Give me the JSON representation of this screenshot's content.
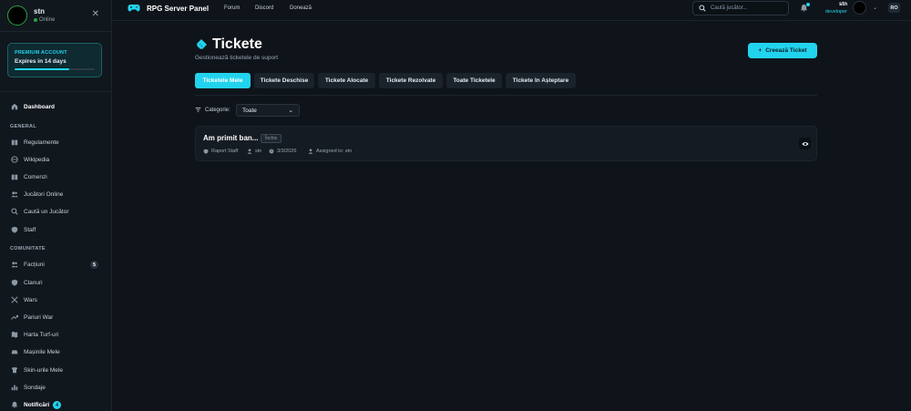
{
  "sidebar": {
    "user": {
      "name": "stn",
      "status": "Online"
    },
    "premium": {
      "title": "PREMIUM ACCOUNT",
      "expires": "Expires in 14 days",
      "progress": 0.68
    },
    "dashboard": "Dashboard",
    "section_general": "GENERAL",
    "general_items": [
      "Regulamente",
      "Wikipedia",
      "Comenzi",
      "Jucători Online",
      "Caută un Jucător",
      "Staff"
    ],
    "section_community": "COMUNITATE",
    "community_items": [
      "Facțiuni",
      "Clanuri",
      "Wars",
      "Pariuri War",
      "Harta Turf-uri",
      "Mașinile Mele",
      "Skin-urile Mele",
      "Sondaje",
      "Notificări"
    ],
    "factiuni_badge": "5",
    "notificari_badge": "4"
  },
  "topbar": {
    "brand": "RPG Server Panel",
    "nav": [
      "Forum",
      "Discord",
      "Donează"
    ],
    "search_placeholder": "Caută jucător...",
    "user_name": "stn",
    "user_role": "developer",
    "lang": "RO"
  },
  "main": {
    "title": "Tickete",
    "subtitle": "Gestionează ticketele de suport",
    "create_label": "Creează Ticket",
    "tabs": [
      "Ticketele Mele",
      "Tickete Deschise",
      "Tickete Alocate",
      "Tickete Rezolvate",
      "Toate Ticketele",
      "Tickete în Așteptare"
    ],
    "filter_label": "Categorie:",
    "filter_value": "Toate",
    "ticket": {
      "title": "Am primit ban...",
      "status": "Închis",
      "category": "Raport Staff",
      "author": "stn",
      "date": "3/3/2026",
      "assigned": "Assigned to: stn"
    }
  },
  "colors": {
    "accent": "#22d3ee",
    "online": "#2ea043",
    "background": "#0f141a"
  }
}
